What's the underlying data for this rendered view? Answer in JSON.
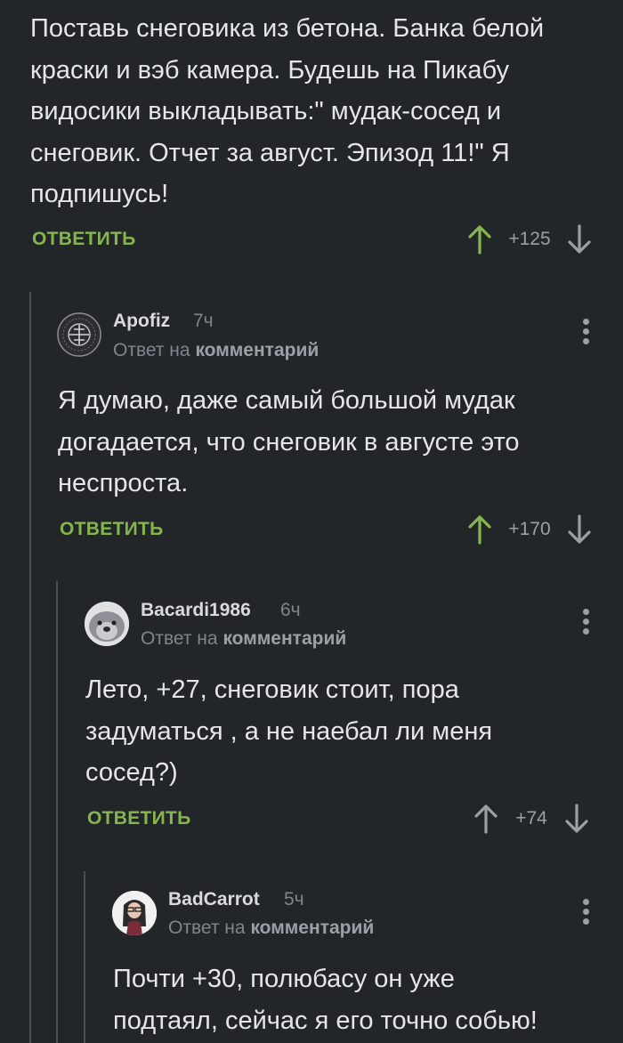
{
  "top_comment": {
    "text": "Поставь снеговика из бетона. Банка белой\nкраски и вэб камера. Будешь на Пикабу\nвидосики выкладывать:\" мудак-сосед и\nснеговик. Отчет за август. Эпизод 11!\" Я\nподпишусь!",
    "reply_label": "ОТВЕТИТЬ",
    "score": "+125"
  },
  "replies": [
    {
      "username": "Apofiz",
      "time": "7ч",
      "reply_prefix": "Ответ на",
      "reply_target": "комментарий",
      "text": "Я думаю, даже самый большой мудак\nдогадается, что снеговик в августе это\nнеспроста.",
      "reply_label": "ОТВЕТИТЬ",
      "score": "+170",
      "upvote_color": "#86b54f"
    },
    {
      "username": "Bacardi1986",
      "time": "6ч",
      "reply_prefix": "Ответ на",
      "reply_target": "комментарий",
      "text": "Лето, +27, снеговик стоит, пора\nзадуматься , а не наебал ли меня\nсосед?)",
      "reply_label": "ОТВЕТИТЬ",
      "score": "+74",
      "upvote_color": "#9aa0a6"
    },
    {
      "username": "BadCarrot",
      "time": "5ч",
      "reply_prefix": "Ответ на",
      "reply_target": "комментарий",
      "text": "Почти +30, полюбасу он уже\nподтаял, сейчас я его точно собью!"
    }
  ],
  "colors": {
    "background": "#232629",
    "accent_green": "#86b54f",
    "thread_line": "#4b4f54"
  }
}
